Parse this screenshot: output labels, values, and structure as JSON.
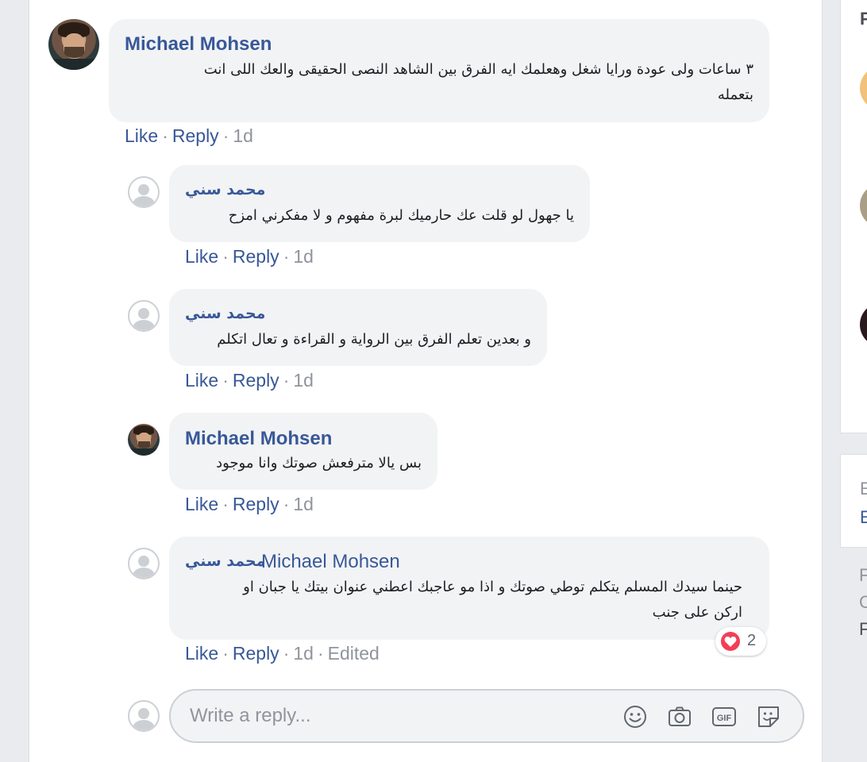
{
  "comments": [
    {
      "author": "Michael Mohsen",
      "lines": [
        "٣ ساعات ولى عودة ورايا شغل وهعلمك ايه الفرق بين الشاهد النصى الحقيقى والعك اللى انت",
        "بتعمله"
      ],
      "like": "Like",
      "reply": "Reply",
      "time": "1d"
    },
    {
      "author": "محمد سني",
      "lines": [
        "يا جهول لو قلت عك حارميك لبرة مفهوم و لا مفكرني امزح"
      ],
      "like": "Like",
      "reply": "Reply",
      "time": "1d"
    },
    {
      "author": "محمد سني",
      "lines": [
        "و بعدين تعلم الفرق بين الرواية و القراءة و تعال اتكلم"
      ],
      "like": "Like",
      "reply": "Reply",
      "time": "1d"
    },
    {
      "author": "Michael Mohsen",
      "lines": [
        "بس يالا مترفعش صوتك وانا موجود"
      ],
      "like": "Like",
      "reply": "Reply",
      "time": "1d"
    },
    {
      "author": "محمد سني",
      "mention": "Michael Mohsen",
      "lines": [
        "حينما سيدك المسلم يتكلم توطي صوتك و اذا مو عاجبك اعطني عنوان بيتك يا جبان او",
        "اركن على جنب"
      ],
      "like": "Like",
      "reply": "Reply",
      "time": "1d",
      "edited": "Edited",
      "reaction_count": "2",
      "reaction_icon": "heart-reaction-icon"
    }
  ],
  "reply_box": {
    "placeholder": "Write a reply...",
    "icons": [
      "emoji-icon",
      "camera-icon",
      "gif-icon",
      "sticker-icon"
    ]
  },
  "right_rail": {
    "letters": [
      "F",
      "E",
      "E",
      "F",
      "C",
      "F"
    ]
  },
  "colors": {
    "link": "#385898",
    "bubble": "#f2f3f5",
    "meta": "#90949c",
    "heart": "#f33e58"
  }
}
